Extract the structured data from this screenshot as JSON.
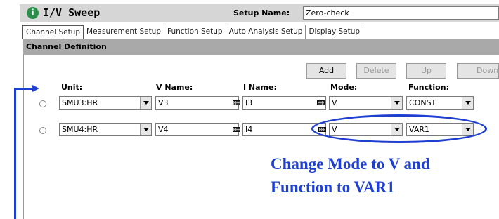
{
  "app": {
    "title": "I/V Sweep",
    "info_icon": "info-icon"
  },
  "setup": {
    "label": "Setup Name:",
    "value": "Zero-check"
  },
  "tabs": [
    {
      "label": "Channel Setup",
      "active": true
    },
    {
      "label": "Measurement Setup"
    },
    {
      "label": "Function Setup"
    },
    {
      "label": "Auto Analysis Setup"
    },
    {
      "label": "Display Setup"
    }
  ],
  "panel": {
    "header": "Channel Definition"
  },
  "buttons": {
    "add": "Add",
    "delete": "Delete",
    "up": "Up",
    "down": "Down"
  },
  "columns": {
    "unit": "Unit:",
    "vname": "V Name:",
    "iname": "I Name:",
    "mode": "Mode:",
    "function": "Function:"
  },
  "rows": [
    {
      "unit": "SMU3:HR",
      "vname": "V3",
      "iname": "I3",
      "mode": "V",
      "function": "CONST"
    },
    {
      "unit": "SMU4:HR",
      "vname": "V4",
      "iname": "I4",
      "mode": "V",
      "function": "VAR1"
    }
  ],
  "annotation": {
    "line1": "Change Mode to V and",
    "line2": "Function to VAR1",
    "color": "#1f3fd0"
  }
}
